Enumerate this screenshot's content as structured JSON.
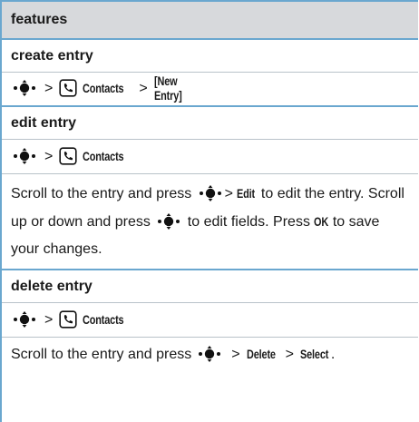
{
  "header": {
    "title": "features"
  },
  "sections": [
    {
      "title": "create entry",
      "path": {
        "app": "Contacts",
        "tail": "[New Entry]"
      }
    },
    {
      "title": "edit entry",
      "path": {
        "app": "Contacts"
      },
      "desc": {
        "part1": "Scroll to the entry and press",
        "edit": "Edit",
        "part2": "to edit the entry. Scroll up or down and press",
        "part3": "to edit fields. Press",
        "ok": "OK",
        "part4": "to save your changes."
      }
    },
    {
      "title": "delete entry",
      "path": {
        "app": "Contacts"
      },
      "desc": {
        "part1": "Scroll to the entry and press",
        "delete": "Delete",
        "select": "Select",
        "end": "."
      }
    }
  ],
  "symbols": {
    "gt": ">"
  },
  "icons": {
    "nav": "nav-key-icon",
    "phone": "phone-icon"
  },
  "colors": {
    "accent_rule": "#6aa7cf",
    "header_bg": "#d7d9dc",
    "divider": "#b9c2c9"
  }
}
